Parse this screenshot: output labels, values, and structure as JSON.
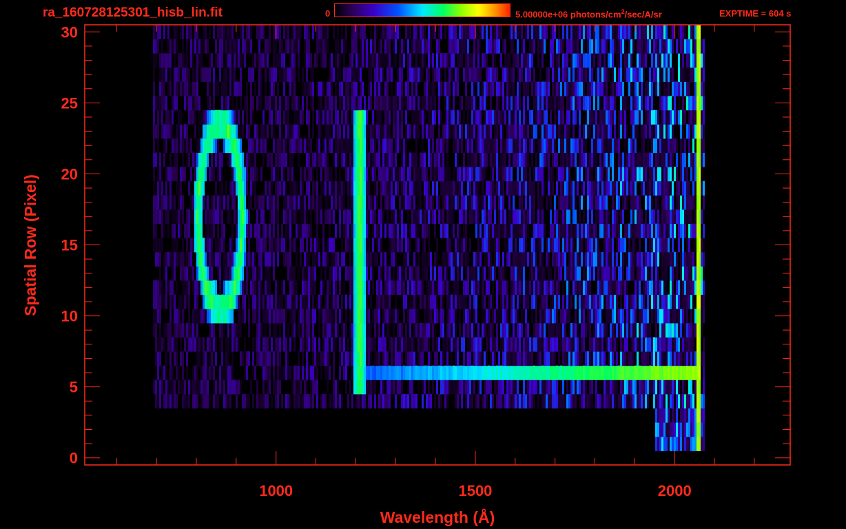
{
  "header": {
    "title": "ra_160728125301_hisb_lin.fit",
    "colorbar_min": "0",
    "colorbar_max_value": "5.00000e+06",
    "colorbar_max_unit_prefix": " photons/cm",
    "colorbar_max_unit_exp": "2",
    "colorbar_max_unit_suffix": "/sec/A/sr",
    "exptime": "EXPTIME = 604 s"
  },
  "chart_data": {
    "type": "heatmap",
    "title": "ra_160728125301_hisb_lin.fit",
    "xlabel": "Wavelength (Å)",
    "ylabel": "Spatial Row (Pixel)",
    "xlim": [
      520,
      2290
    ],
    "ylim": [
      -0.5,
      30.5
    ],
    "xticks": [
      1000,
      1500,
      2000
    ],
    "yticks": [
      0,
      5,
      10,
      15,
      20,
      25,
      30
    ],
    "colorbar": {
      "min": 0,
      "max": 5000000,
      "colormap": [
        "#000000",
        "#2b0057",
        "#3a00c8",
        "#0050ff",
        "#00e8ff",
        "#00ff60",
        "#8cff00",
        "#ffff00",
        "#ff9900",
        "#ff2200"
      ]
    },
    "features": [
      {
        "name": "ring",
        "center_wavelength": 860,
        "center_row": 17,
        "radius_wavelength": 55,
        "radius_rows": 6.5,
        "level": 0.55
      },
      {
        "name": "vertical_line",
        "wavelength": 1210,
        "rows": [
          5,
          24
        ],
        "level": 0.6
      },
      {
        "name": "horizontal_band",
        "row": 6.5,
        "wavelength": [
          1200,
          2060
        ],
        "level": 0.55
      },
      {
        "name": "edge_band",
        "wavelength": 2060,
        "rows": [
          1,
          30
        ],
        "level": 0.65
      }
    ]
  }
}
